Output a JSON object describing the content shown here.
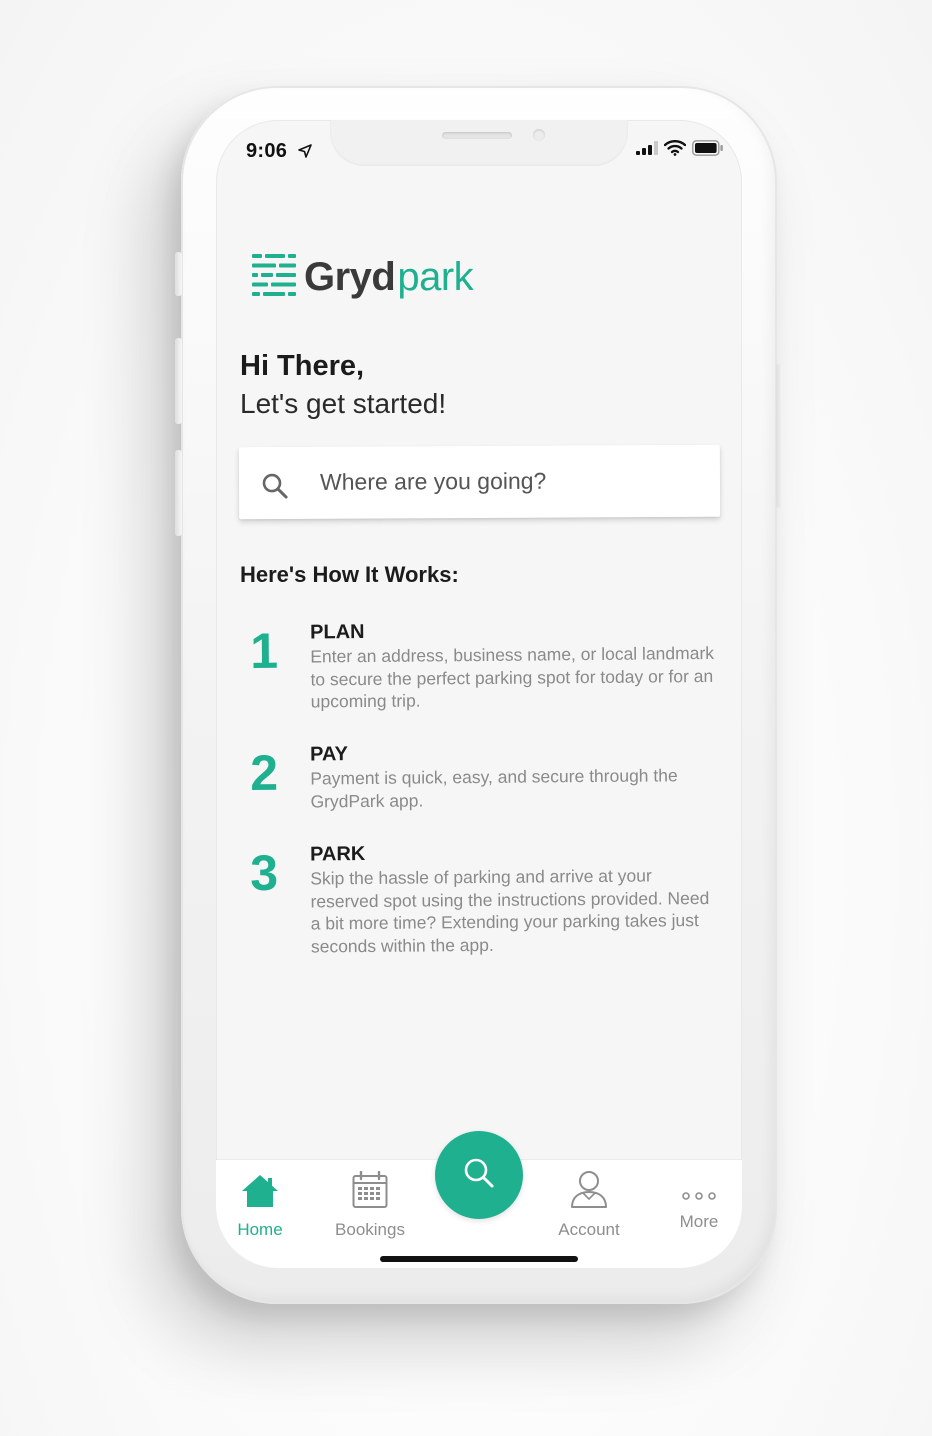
{
  "status_bar": {
    "time": "9:06",
    "icons": [
      "location-arrow-icon",
      "signal-icon",
      "wifi-icon",
      "battery-icon"
    ]
  },
  "brand": {
    "word1": "Gryd",
    "word2": "park",
    "colors": {
      "accent": "#1fb08f",
      "dark": "#3a3a3a"
    }
  },
  "greeting": {
    "title": "Hi There,",
    "subtitle": "Let's get started!"
  },
  "search": {
    "placeholder": "Where are you going?",
    "icon": "search-icon"
  },
  "how_it_works": {
    "title": "Here's How It Works:",
    "steps": [
      {
        "number": "1",
        "heading": "PLAN",
        "body": "Enter an address, business name, or local landmark to secure the perfect parking spot for today or for an upcoming trip."
      },
      {
        "number": "2",
        "heading": "PAY",
        "body": "Payment is quick, easy, and secure through the GrydPark app."
      },
      {
        "number": "3",
        "heading": "PARK",
        "body": "Skip the hassle of parking and arrive at your reserved spot using the instructions provided. Need a bit more time? Extending your parking takes just seconds within the app."
      }
    ]
  },
  "tabbar": {
    "items": [
      {
        "label": "Home",
        "icon": "home-icon",
        "active": true
      },
      {
        "label": "Bookings",
        "icon": "calendar-icon",
        "active": false
      },
      {
        "label": "Account",
        "icon": "user-icon",
        "active": false
      },
      {
        "label": "More",
        "icon": "more-dots-icon",
        "active": false
      }
    ],
    "center_action_icon": "search-icon"
  }
}
